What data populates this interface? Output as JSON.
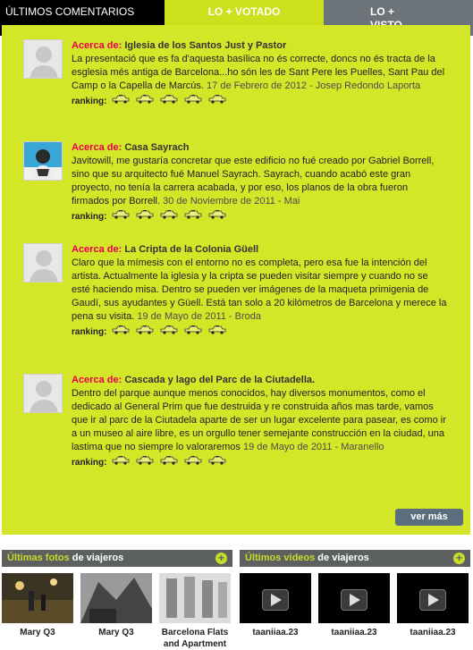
{
  "tabs": {
    "comentarios": "Últimos comentarios",
    "votado": "LO + VOTADO",
    "visto_line1": "LO +",
    "visto_line2": "VISTO"
  },
  "comments": [
    {
      "label": "Acerca de:",
      "title": "Iglesia de los Santos Just y Pastor",
      "body": "La presentació que es fa d'aquesta basílica no és correcte, doncs no és tracta de la esglesia més antiga de Barcelona...ho són les de Sant Pere les Puelles, Sant Pau del Camp o la Capella de Marcús.",
      "meta": "17 de Febrero de 2012 - Josep Redondo Laporta",
      "ranking": "ranking:"
    },
    {
      "label": "Acerca de:",
      "title": "Casa Sayrach",
      "body": "Javitowill, me gustaría concretar que este edificio no fué creado por Gabriel Borrell, sino que su arquitecto fué Manuel Sayrach. Sayrach, cuando acabó este gran proyecto, no tenía la carrera acabada, y por eso, los planos de la obra fueron firmados por Borrell.",
      "meta": "30 de Noviembre de 2011 - Mai",
      "ranking": "ranking:"
    },
    {
      "label": "Acerca de:",
      "title": "La Cripta de la Colonia Güell",
      "body": "Claro que la mímesis con el entorno no es completa, pero esa fue la intención del artista. Actualmente la iglesia y la cripta se pueden visitar siempre y cuando no se esté haciendo misa. Dentro se pueden ver imágenes de la maqueta primigenia de Gaudí, sus ayudantes y Güell. Está tan solo a 20 kilómetros de Barcelona y merece la pena su visita.",
      "meta": "19 de Mayo de 2011 - Broda",
      "ranking": "ranking:"
    },
    {
      "label": "Acerca de:",
      "title": "Cascada y lago del Parc de la Ciutadella.",
      "body": "Dentro del parque aunque menos conocidos, hay diversos monumentos, como el dedicado al General Prim que fue destruida y re construida años mas tarde, vamos que ir al parc de la Ciutadela aparte de ser un lugar excelente para pasear, es como ir a un museo al aire libre, es un orgullo tener semejante construcción en la ciudad, una lastima que no siempre lo valoraremos",
      "meta": "19 de Mayo de 2011 - Maranello",
      "ranking": "ranking:"
    }
  ],
  "ver_mas": "ver más",
  "fotos": {
    "title_hl": "Últimas fotos",
    "title_rest": " de viajeros",
    "items": [
      {
        "caption": "Mary Q3"
      },
      {
        "caption": "Mary Q3"
      },
      {
        "caption": "Barcelona Flats and Apartment"
      }
    ]
  },
  "videos": {
    "title_hl": "Últimos videos",
    "title_rest": " de viajeros",
    "items": [
      {
        "caption": "taaniiaa.23"
      },
      {
        "caption": "taaniiaa.23"
      },
      {
        "caption": "taaniiaa.23"
      }
    ]
  },
  "colors": {
    "accent_green": "#d4e628",
    "label_red": "#e8004e",
    "button_slate": "#5b6e7e"
  }
}
